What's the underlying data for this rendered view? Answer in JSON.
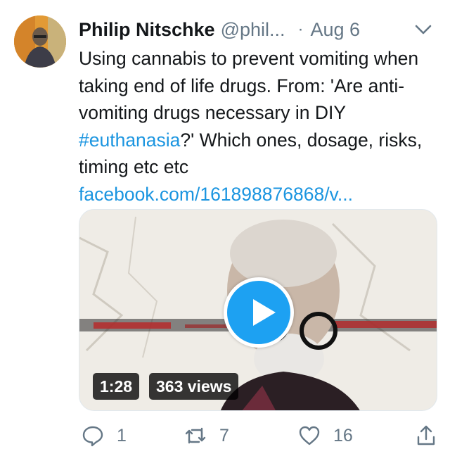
{
  "tweet": {
    "author_name": "Philip Nitschke",
    "author_handle": "@phil...",
    "separator": "·",
    "date": "Aug 6",
    "text_before_hashtag": "Using cannabis to prevent vomiting when taking end of life drugs. From: 'Are anti-vomiting drugs necessary in DIY ",
    "hashtag": "#euthanasia",
    "text_after_hashtag": "?' Which ones, dosage, risks, timing etc etc",
    "link": "facebook.com/161898876868/v..."
  },
  "media": {
    "duration": "1:28",
    "views": "363 views"
  },
  "actions": {
    "reply_count": "1",
    "retweet_count": "7",
    "like_count": "16"
  },
  "colors": {
    "link": "#1b95e0",
    "play_button": "#1da1f2",
    "muted_text": "#657786"
  },
  "icons": {
    "chevron": "chevron-down-icon",
    "reply": "reply-icon",
    "retweet": "retweet-icon",
    "like": "heart-icon",
    "share": "share-icon",
    "play": "play-icon"
  }
}
